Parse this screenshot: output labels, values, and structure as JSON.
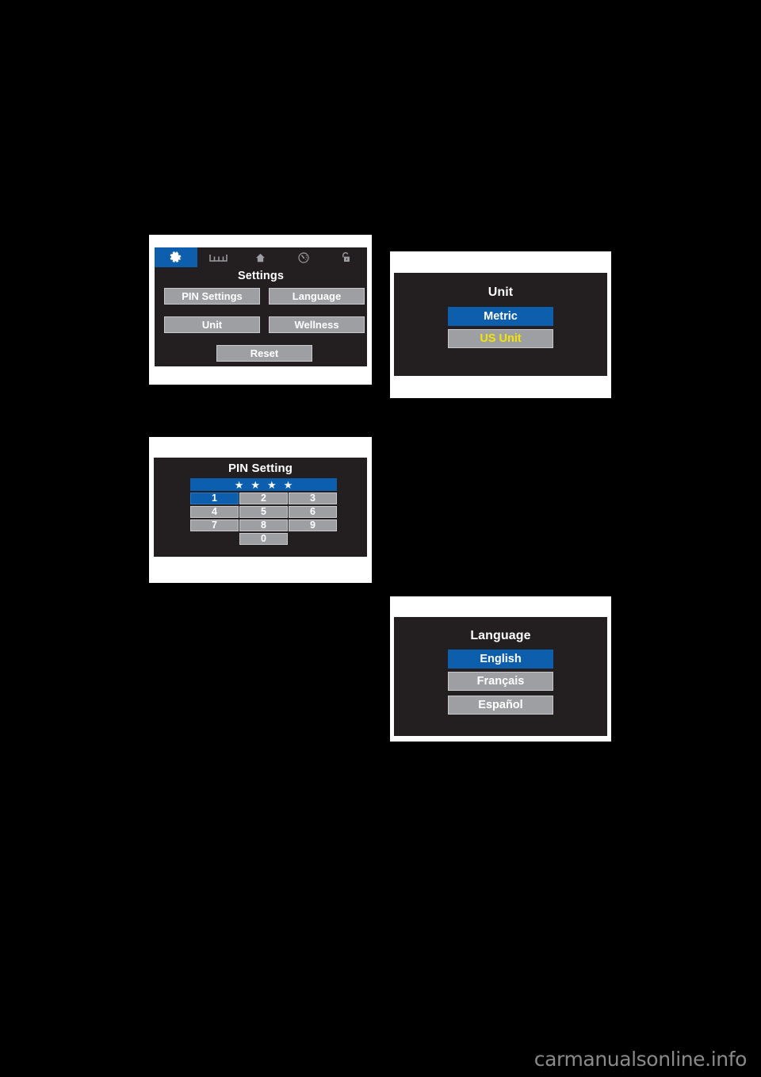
{
  "page": {
    "background_color": "#000000",
    "watermark": "carmanualsonline.info"
  },
  "theme": {
    "screen_background": "#231f20",
    "button_gray": "#9d9fa2",
    "highlight_blue": "#0d5fae",
    "text_white": "#ffffff",
    "text_yellow": "#f3e500",
    "panel_white": "#ffffff"
  },
  "figures": {
    "settings": {
      "title": "Settings",
      "statusbar": {
        "icons": [
          {
            "name": "gear-icon",
            "label": "Settings",
            "active": true
          },
          {
            "name": "trip-meter-icon",
            "label": "Trip Meter",
            "active": false
          },
          {
            "name": "home-icon",
            "label": "Home",
            "active": false
          },
          {
            "name": "gauge-icon",
            "label": "Gauge",
            "active": false
          },
          {
            "name": "lock-icon",
            "label": "Lock",
            "active": false
          }
        ]
      },
      "buttons": [
        {
          "name": "pin-settings-button",
          "label": "PIN Settings",
          "selected": false
        },
        {
          "name": "language-button",
          "label": "Language",
          "selected": false
        },
        {
          "name": "unit-button",
          "label": "Unit",
          "selected": false
        },
        {
          "name": "wellness-button",
          "label": "Wellness",
          "selected": false
        },
        {
          "name": "reset-button",
          "label": "Reset",
          "selected": false
        }
      ]
    },
    "pin": {
      "title": "PIN Setting",
      "entry_mask": [
        "★",
        "★",
        "★",
        "★"
      ],
      "keys": [
        {
          "label": "1",
          "selected": true
        },
        {
          "label": "2",
          "selected": false
        },
        {
          "label": "3",
          "selected": false
        },
        {
          "label": "4",
          "selected": false
        },
        {
          "label": "5",
          "selected": false
        },
        {
          "label": "6",
          "selected": false
        },
        {
          "label": "7",
          "selected": false
        },
        {
          "label": "8",
          "selected": false
        },
        {
          "label": "9",
          "selected": false
        },
        {
          "label": "0",
          "selected": false
        }
      ]
    },
    "unit": {
      "title": "Unit",
      "options": [
        {
          "label": "Metric",
          "selected": true,
          "warn": false
        },
        {
          "label": "US Unit",
          "selected": false,
          "warn": true
        }
      ]
    },
    "language": {
      "title": "Language",
      "options": [
        {
          "label": "English",
          "selected": true,
          "warn": false
        },
        {
          "label": "Français",
          "selected": false,
          "warn": false
        },
        {
          "label": "Español",
          "selected": false,
          "warn": false
        }
      ]
    }
  }
}
